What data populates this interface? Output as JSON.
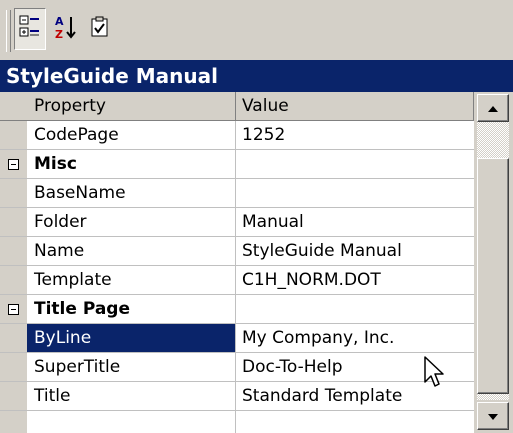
{
  "toolbar": {
    "buttons": [
      {
        "name": "categorized-icon",
        "pressed": true
      },
      {
        "name": "alphabetical-sort-icon",
        "pressed": false
      },
      {
        "name": "property-pages-icon",
        "pressed": false
      }
    ]
  },
  "panel": {
    "title": "StyleGuide Manual"
  },
  "grid": {
    "header": {
      "property": "Property",
      "value": "Value"
    },
    "rows": [
      {
        "type": "property",
        "name": "CodePage",
        "value": "1252"
      },
      {
        "type": "category",
        "name": "Misc",
        "value": ""
      },
      {
        "type": "property",
        "name": "BaseName",
        "value": ""
      },
      {
        "type": "property",
        "name": "Folder",
        "value": "Manual"
      },
      {
        "type": "property",
        "name": "Name",
        "value": "StyleGuide Manual"
      },
      {
        "type": "property",
        "name": "Template",
        "value": "C1H_NORM.DOT"
      },
      {
        "type": "category",
        "name": "Title Page",
        "value": ""
      },
      {
        "type": "property",
        "name": "ByLine",
        "value": "My Company, Inc.",
        "selected": true
      },
      {
        "type": "property",
        "name": "SuperTitle",
        "value": "Doc-To-Help"
      },
      {
        "type": "property",
        "name": "Title",
        "value": "Standard Template"
      }
    ]
  },
  "scrollbar": {
    "position": 0.85
  },
  "colors": {
    "selection": "#0a246a",
    "face": "#d4d0c8"
  }
}
